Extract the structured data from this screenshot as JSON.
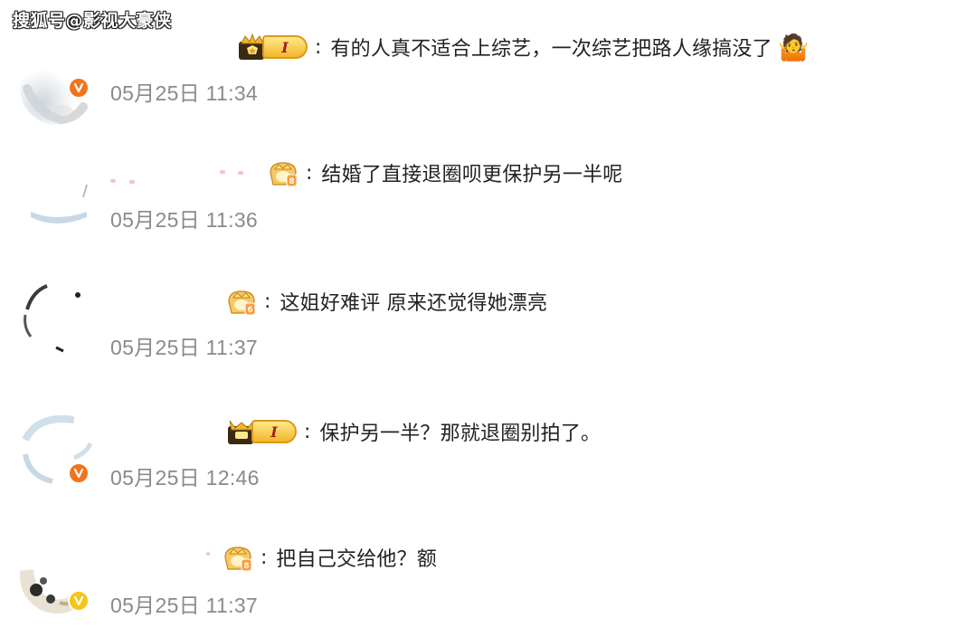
{
  "watermark": "搜狐号@影视大豪侠",
  "colors": {
    "time": "#8a8a8a",
    "verified_orange": "#f0741e",
    "verified_gold": "#f5c518",
    "badge_gold": "#f3b62a"
  },
  "comments": [
    {
      "text": "有的人真不适合上综艺，一次综艺把路人缘搞没了",
      "time": "05月25日 11:34",
      "badge": "crown-level-pill",
      "badge_level": "I",
      "emoji": "shrug-emoji",
      "verified": "orange"
    },
    {
      "text": "结婚了直接退圈呗更保护另一半呢",
      "time": "05月25日 11:36",
      "badge": "crown-level-8",
      "verified": "none"
    },
    {
      "text": "这姐好难评 原来还觉得她漂亮",
      "time": "05月25日 11:37",
      "badge": "crown-level-6",
      "verified": "none"
    },
    {
      "text": "保护另一半？那就退圈别拍了。",
      "time": "05月25日 12:46",
      "badge": "crown-level-pill",
      "badge_level": "I",
      "verified": "orange"
    },
    {
      "text": "把自己交给他？额",
      "time": "05月25日 11:37",
      "badge": "crown-level-8",
      "verified": "gold"
    }
  ]
}
